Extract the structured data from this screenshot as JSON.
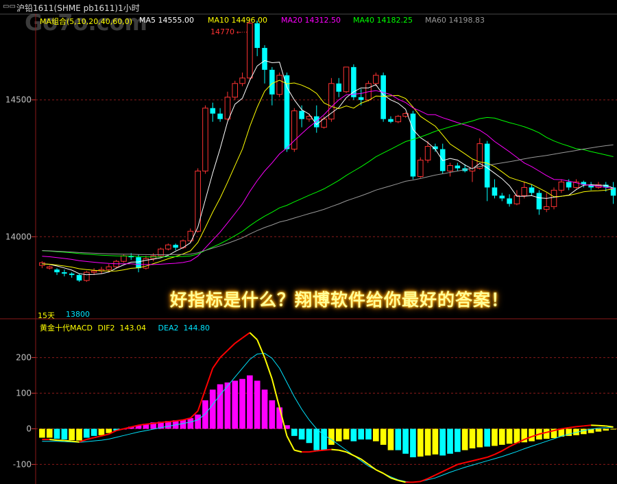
{
  "window": {
    "title": "沪铅1611(SHME pb1611)1小时",
    "icon": "window-icon"
  },
  "watermark": "Go7o.com",
  "banner": "好指标是什么？翔博软件给你最好的答案！",
  "ma_legend": {
    "group": "MA组合(5,10,20,40,60,0)",
    "items": [
      {
        "label": "MA5",
        "value": "14555.00",
        "color": "#ffffff"
      },
      {
        "label": "MA10",
        "value": "14496.00",
        "color": "#ffff00"
      },
      {
        "label": "MA20",
        "value": "14312.50",
        "color": "#ff00ff"
      },
      {
        "label": "MA40",
        "value": "14182.25",
        "color": "#00ff00"
      },
      {
        "label": "MA60",
        "value": "14198.83",
        "color": "#999999"
      }
    ]
  },
  "annotations": {
    "high": "14770",
    "low": "13800",
    "period": "15天"
  },
  "macd_legend": {
    "name": "黄金十代MACD",
    "dif_label": "DIF2",
    "dif_value": "143.04",
    "dea_label": "DEA2",
    "dea_value": "144.80"
  },
  "colors": {
    "up": "#ff3333",
    "down": "#00ffff",
    "grid": "#8b1a1a",
    "ma5": "#ffffff",
    "ma10": "#ffff00",
    "ma20": "#ff00ff",
    "ma40": "#00ff00",
    "ma60": "#999999",
    "dif": "#ff0000",
    "dif_fall": "#ffff00",
    "dea": "#00e5ff",
    "hist_pos": "#ff00ff",
    "hist_neg": "#00ffff",
    "hist_yellow": "#ffff00"
  },
  "chart_data": [
    {
      "type": "candlestick",
      "title": "沪铅1611(SHME pb1611)1小时",
      "y_ticks": [
        14000,
        14500
      ],
      "ylim": [
        13700,
        14790
      ],
      "candles": [
        [
          13895,
          13905,
          13885,
          13910
        ],
        [
          13885,
          13890,
          13880,
          13895
        ],
        [
          13880,
          13870,
          13860,
          13885
        ],
        [
          13870,
          13865,
          13855,
          13880
        ],
        [
          13865,
          13860,
          13850,
          13870
        ],
        [
          13860,
          13840,
          13835,
          13865
        ],
        [
          13840,
          13870,
          13835,
          13875
        ],
        [
          13870,
          13875,
          13860,
          13885
        ],
        [
          13875,
          13880,
          13865,
          13890
        ],
        [
          13880,
          13890,
          13870,
          13900
        ],
        [
          13890,
          13910,
          13885,
          13915
        ],
        [
          13910,
          13930,
          13905,
          13935
        ],
        [
          13930,
          13925,
          13915,
          13940
        ],
        [
          13925,
          13885,
          13870,
          13935
        ],
        [
          13885,
          13920,
          13880,
          13930
        ],
        [
          13920,
          13930,
          13910,
          13940
        ],
        [
          13930,
          13955,
          13925,
          13960
        ],
        [
          13955,
          13970,
          13950,
          13975
        ],
        [
          13970,
          13960,
          13950,
          13975
        ],
        [
          13960,
          13985,
          13955,
          13990
        ],
        [
          13985,
          14020,
          13980,
          14030
        ],
        [
          14020,
          14240,
          14015,
          14250
        ],
        [
          14240,
          14470,
          14230,
          14480
        ],
        [
          14470,
          14450,
          14420,
          14490
        ],
        [
          14450,
          14430,
          14420,
          14470
        ],
        [
          14430,
          14510,
          14425,
          14530
        ],
        [
          14510,
          14560,
          14500,
          14570
        ],
        [
          14560,
          14580,
          14550,
          14600
        ],
        [
          14580,
          14780,
          14575,
          14790
        ],
        [
          14780,
          14690,
          14660,
          14790
        ],
        [
          14690,
          14610,
          14560,
          14700
        ],
        [
          14610,
          14520,
          14480,
          14620
        ],
        [
          14520,
          14590,
          14510,
          14600
        ],
        [
          14590,
          14320,
          14310,
          14600
        ],
        [
          14320,
          14460,
          14310,
          14470
        ],
        [
          14460,
          14430,
          14400,
          14480
        ],
        [
          14430,
          14440,
          14420,
          14450
        ],
        [
          14440,
          14400,
          14380,
          14480
        ],
        [
          14400,
          14430,
          14395,
          14440
        ],
        [
          14430,
          14560,
          14420,
          14580
        ],
        [
          14560,
          14530,
          14510,
          14580
        ],
        [
          14530,
          14620,
          14525,
          14620
        ],
        [
          14620,
          14510,
          14500,
          14630
        ],
        [
          14510,
          14500,
          14480,
          14540
        ],
        [
          14500,
          14560,
          14495,
          14570
        ],
        [
          14560,
          14590,
          14550,
          14600
        ],
        [
          14590,
          14430,
          14420,
          14600
        ],
        [
          14430,
          14420,
          14415,
          14440
        ],
        [
          14420,
          14440,
          14415,
          14445
        ],
        [
          14440,
          14450,
          14435,
          14455
        ],
        [
          14450,
          14220,
          14210,
          14460
        ],
        [
          14220,
          14280,
          14215,
          14290
        ],
        [
          14280,
          14330,
          14270,
          14350
        ],
        [
          14330,
          14320,
          14310,
          14340
        ],
        [
          14320,
          14240,
          14230,
          14340
        ],
        [
          14240,
          14260,
          14220,
          14270
        ],
        [
          14260,
          14250,
          14240,
          14270
        ],
        [
          14250,
          14240,
          14235,
          14265
        ],
        [
          14240,
          14250,
          14200,
          14280
        ],
        [
          14250,
          14340,
          14245,
          14360
        ],
        [
          14340,
          14180,
          14130,
          14350
        ],
        [
          14180,
          14150,
          14140,
          14210
        ],
        [
          14150,
          14140,
          14130,
          14160
        ],
        [
          14140,
          14120,
          14110,
          14155
        ],
        [
          14120,
          14150,
          14115,
          14170
        ],
        [
          14150,
          14180,
          14140,
          14200
        ],
        [
          14180,
          14160,
          14150,
          14190
        ],
        [
          14160,
          14100,
          14080,
          14170
        ],
        [
          14100,
          14110,
          14090,
          14160
        ],
        [
          14110,
          14170,
          14100,
          14180
        ],
        [
          14170,
          14200,
          14160,
          14210
        ],
        [
          14200,
          14180,
          14170,
          14210
        ],
        [
          14180,
          14200,
          14175,
          14210
        ],
        [
          14200,
          14190,
          14180,
          14205
        ],
        [
          14190,
          14180,
          14170,
          14200
        ],
        [
          14180,
          14190,
          14175,
          14200
        ],
        [
          14190,
          14180,
          14165,
          14200
        ],
        [
          14180,
          14150,
          14120,
          14200
        ]
      ],
      "ma_final": {
        "MA5": 14555.0,
        "MA10": 14496.0,
        "MA20": 14312.5,
        "MA40": 14182.25,
        "MA60": 14198.83
      }
    },
    {
      "type": "macd",
      "title": "黄金十代MACD",
      "y_ticks": [
        200,
        100,
        0,
        -100
      ],
      "ylim": [
        -155,
        280
      ],
      "hist": [
        -25,
        -25,
        -28,
        -30,
        -32,
        -33,
        -25,
        -20,
        -18,
        -12,
        -5,
        0,
        6,
        10,
        14,
        18,
        20,
        22,
        24,
        26,
        30,
        40,
        80,
        110,
        125,
        130,
        135,
        140,
        150,
        135,
        110,
        80,
        60,
        10,
        -20,
        -30,
        -40,
        -60,
        -60,
        -45,
        -35,
        -30,
        -35,
        -30,
        -30,
        -35,
        -45,
        -60,
        -60,
        -70,
        -80,
        -78,
        -75,
        -72,
        -75,
        -70,
        -65,
        -60,
        -55,
        -52,
        -50,
        -48,
        -45,
        -42,
        -40,
        -38,
        -35,
        -30,
        -28,
        -26,
        -22,
        -20,
        -18,
        -15,
        -12,
        -8,
        -5,
        -2
      ],
      "dif": [
        -30,
        -30,
        -32,
        -33,
        -35,
        -37,
        -30,
        -25,
        -20,
        -15,
        -5,
        0,
        5,
        10,
        13,
        15,
        18,
        20,
        22,
        25,
        30,
        50,
        110,
        170,
        200,
        220,
        240,
        255,
        270,
        250,
        200,
        140,
        60,
        -20,
        -60,
        -65,
        -65,
        -62,
        -60,
        -58,
        -60,
        -65,
        -75,
        -85,
        -100,
        -115,
        -125,
        -138,
        -145,
        -150,
        -150,
        -148,
        -140,
        -130,
        -120,
        -110,
        -100,
        -95,
        -90,
        -85,
        -80,
        -72,
        -62,
        -50,
        -40,
        -30,
        -22,
        -15,
        -10,
        -5,
        0,
        3,
        6,
        8,
        10,
        9,
        8,
        5
      ],
      "dea": [
        -35,
        -35,
        -35,
        -36,
        -37,
        -38,
        -36,
        -34,
        -32,
        -29,
        -24,
        -19,
        -14,
        -9,
        -5,
        -1,
        3,
        7,
        11,
        15,
        19,
        25,
        42,
        68,
        95,
        120,
        145,
        170,
        195,
        210,
        212,
        198,
        170,
        130,
        90,
        55,
        25,
        0,
        -18,
        -30,
        -45,
        -60,
        -75,
        -90,
        -105,
        -115,
        -125,
        -135,
        -143,
        -148,
        -150,
        -148,
        -143,
        -138,
        -130,
        -122,
        -115,
        -108,
        -102,
        -96,
        -90,
        -84,
        -78,
        -71,
        -64,
        -56,
        -49,
        -42,
        -35,
        -28,
        -21,
        -15,
        -10,
        -5,
        -1,
        2,
        3,
        4
      ]
    }
  ]
}
